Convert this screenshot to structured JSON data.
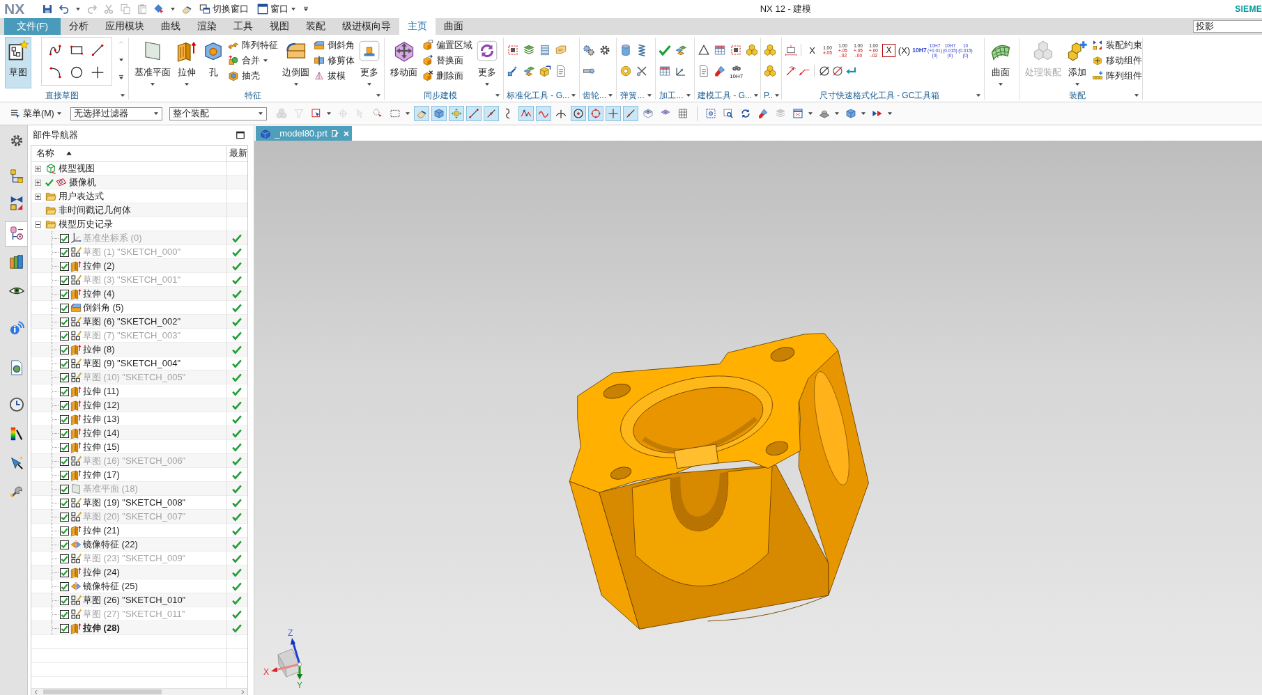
{
  "title_bar": {
    "logo": "NX",
    "quick_access": [
      {
        "label": "切换窗口",
        "dropdown": false
      },
      {
        "label": "窗口",
        "dropdown": true
      }
    ],
    "title": "NX 12 - 建模",
    "brand": "SIEME"
  },
  "menu_tabs": [
    {
      "label": "文件(F)",
      "kind": "file",
      "selected": false
    },
    {
      "label": "分析",
      "kind": "tab",
      "selected": false
    },
    {
      "label": "应用模块",
      "kind": "tab",
      "selected": false
    },
    {
      "label": "曲线",
      "kind": "tab",
      "selected": false
    },
    {
      "label": "渲染",
      "kind": "tab",
      "selected": false
    },
    {
      "label": "工具",
      "kind": "tab",
      "selected": false
    },
    {
      "label": "视图",
      "kind": "tab",
      "selected": false
    },
    {
      "label": "装配",
      "kind": "tab",
      "selected": false
    },
    {
      "label": "级进模向导",
      "kind": "tab",
      "selected": false
    },
    {
      "label": "主页",
      "kind": "tab",
      "selected": true
    },
    {
      "label": "曲面",
      "kind": "tab",
      "selected": false
    }
  ],
  "command_search": {
    "value": "投影"
  },
  "ribbon_groups": [
    {
      "label": "直接草图",
      "columns": [
        {
          "kind": "large",
          "label": "草图",
          "active": true,
          "disabled": false,
          "dropdown": false
        },
        {
          "kind": "gallery"
        }
      ]
    },
    {
      "label": "特征",
      "columns": [
        {
          "kind": "large",
          "label": "基准平面",
          "active": false,
          "disabled": false,
          "dropdown": true
        },
        {
          "kind": "large",
          "label": "拉伸",
          "active": false,
          "disabled": false,
          "dropdown": true
        },
        {
          "kind": "large",
          "label": "孔",
          "active": false,
          "disabled": false,
          "dropdown": false
        },
        {
          "kind": "stack",
          "items": [
            {
              "label": "阵列特征",
              "dropdown": false
            },
            {
              "label": "合并",
              "dropdown": true
            },
            {
              "label": "抽壳",
              "dropdown": false
            }
          ]
        },
        {
          "kind": "large",
          "label": "边倒圆",
          "active": false,
          "disabled": false,
          "dropdown": true
        },
        {
          "kind": "stack",
          "items": [
            {
              "label": "倒斜角",
              "dropdown": false
            },
            {
              "label": "修剪体",
              "dropdown": false
            },
            {
              "label": "拔模",
              "dropdown": false
            }
          ]
        },
        {
          "kind": "large",
          "label": "更多",
          "active": false,
          "disabled": false,
          "dropdown": true
        }
      ]
    },
    {
      "label": "同步建模",
      "columns": [
        {
          "kind": "large",
          "label": "移动面",
          "active": false,
          "disabled": false,
          "dropdown": false
        },
        {
          "kind": "stack",
          "items": [
            {
              "label": "偏置区域",
              "dropdown": false
            },
            {
              "label": "替换面",
              "dropdown": false
            },
            {
              "label": "删除面",
              "dropdown": false
            }
          ]
        },
        {
          "kind": "large",
          "label": "更多",
          "active": false,
          "disabled": false,
          "dropdown": true
        }
      ]
    },
    {
      "label": "标准化工具 - G...",
      "columns": [
        {
          "kind": "icons"
        }
      ]
    },
    {
      "label": "齿轮...",
      "columns": [
        {
          "kind": "icons"
        }
      ]
    },
    {
      "label": "弹簧...",
      "columns": [
        {
          "kind": "icons"
        }
      ]
    },
    {
      "label": "加工...",
      "columns": [
        {
          "kind": "icons"
        }
      ]
    },
    {
      "label": "建模工具 - G...",
      "columns": [
        {
          "kind": "icons",
          "caption": "10H7"
        }
      ]
    },
    {
      "label": "P..",
      "columns": [
        {
          "kind": "icons"
        }
      ]
    },
    {
      "label": "尺寸快速格式化工具 - GC工具箱",
      "columns": [
        {
          "kind": "format_tools",
          "buttons": [
            {
              "kind": "plain",
              "lines": [
                "X"
              ]
            },
            {
              "kind": "tolerance",
              "lines": [
                "1.00",
                "±.05"
              ]
            },
            {
              "kind": "tolerance",
              "lines": [
                "1.00",
                "+.05",
                "-.02"
              ]
            },
            {
              "kind": "tolerance",
              "lines": [
                "1.00",
                "+.05",
                "-.00"
              ]
            },
            {
              "kind": "tolerance",
              "lines": [
                "1.00",
                "+.00",
                "-.02"
              ]
            },
            {
              "kind": "boxed",
              "lines": [
                "X"
              ]
            },
            {
              "kind": "plain",
              "lines": [
                "(X)"
              ]
            },
            {
              "kind": "fit",
              "lines": [
                "10H7"
              ]
            },
            {
              "kind": "fit",
              "lines": [
                "10H7",
                "(+0.01)",
                "(0)"
              ]
            },
            {
              "kind": "fit",
              "lines": [
                "10H7",
                "(0.015)",
                "(0)"
              ]
            },
            {
              "kind": "fit",
              "lines": [
                "10",
                "(0.015)",
                "(0)"
              ]
            }
          ]
        }
      ]
    },
    {
      "columns": [
        {
          "kind": "large",
          "label": "曲面",
          "active": false,
          "disabled": false,
          "dropdown": true
        }
      ]
    },
    {
      "label": "装配",
      "columns": [
        {
          "kind": "large",
          "label": "处理装配",
          "active": false,
          "disabled": true,
          "dropdown": false
        },
        {
          "kind": "large",
          "label": "添加",
          "active": false,
          "disabled": false,
          "dropdown": true
        },
        {
          "kind": "stack",
          "items": [
            {
              "label": "装配约束",
              "dropdown": false
            },
            {
              "label": "移动组件",
              "dropdown": false
            },
            {
              "label": "阵列组件",
              "dropdown": false
            }
          ]
        }
      ]
    }
  ],
  "selection_bar": {
    "menu": "菜单(M)",
    "filters": [
      "无选择过滤器",
      "整个装配"
    ],
    "tools": [
      {
        "on": false,
        "disabled": true
      },
      {
        "on": false,
        "disabled": true
      },
      {
        "on": false,
        "disabled": false
      },
      {
        "on": false,
        "disabled": true
      },
      {
        "on": false,
        "disabled": true
      },
      {
        "on": false,
        "disabled": false
      },
      {
        "on": false,
        "disabled": false
      },
      {
        "on": true,
        "disabled": false
      },
      {
        "on": true,
        "disabled": false
      },
      {
        "on": true,
        "disabled": false
      },
      {
        "on": true,
        "disabled": false
      },
      {
        "on": true,
        "disabled": false
      },
      {
        "on": false,
        "disabled": false
      },
      {
        "on": true,
        "disabled": false
      },
      {
        "on": true,
        "disabled": false
      },
      {
        "on": false,
        "disabled": false
      },
      {
        "on": true,
        "disabled": false
      },
      {
        "on": true,
        "disabled": false
      },
      {
        "on": true,
        "disabled": false
      },
      {
        "on": true,
        "disabled": false
      },
      {
        "on": false,
        "disabled": false
      },
      {
        "on": false,
        "disabled": false
      },
      {
        "on": false,
        "disabled": false
      },
      {
        "on": false,
        "disabled": false
      },
      {
        "on": false,
        "disabled": false
      },
      {
        "on": false,
        "disabled": false
      },
      {
        "on": false,
        "disabled": false
      },
      {
        "on": false,
        "disabled": true
      },
      {
        "on": false,
        "disabled": false
      },
      {
        "on": false,
        "disabled": false
      },
      {
        "on": false,
        "disabled": false
      },
      {
        "on": false,
        "disabled": false
      }
    ]
  },
  "resource_bar": [
    {
      "selected": false
    },
    {
      "selected": false
    },
    {
      "selected": false
    },
    {
      "selected": true
    },
    {
      "selected": false
    },
    {
      "selected": false
    },
    {
      "selected": false
    },
    {
      "selected": false
    },
    {
      "selected": false
    },
    {
      "selected": false
    },
    {
      "selected": false
    },
    {
      "selected": false
    }
  ],
  "part_navigator": {
    "title": "部件导航器",
    "columns": [
      {
        "label": "名称",
        "sort_ascending": true
      },
      {
        "label": "最新"
      }
    ],
    "nodes": [
      {
        "kind": "model_views",
        "label": "模型视图",
        "expandable": true,
        "expanded": false,
        "status_ok": false
      },
      {
        "kind": "cameras",
        "label": "摄像机",
        "expandable": true,
        "expanded": false,
        "status_ok": true
      },
      {
        "kind": "expressions",
        "label": "用户表达式",
        "expandable": true,
        "expanded": false,
        "status_ok": false
      },
      {
        "kind": "unused_geometry",
        "label": "非时间戳记几何体",
        "expandable": false,
        "status_ok": false
      },
      {
        "kind": "history",
        "label": "模型历史记录",
        "expandable": true,
        "expanded": true,
        "status_ok": false,
        "children": [
          {
            "kind": "datum_csys",
            "label": "基准坐标系 (0)",
            "checked": true,
            "dimmed": true,
            "current": false,
            "up_to_date": true
          },
          {
            "kind": "sketch",
            "label": "草图 (1) \"SKETCH_000\"",
            "checked": true,
            "dimmed": true,
            "current": false,
            "up_to_date": true
          },
          {
            "kind": "extrude",
            "label": "拉伸 (2)",
            "checked": true,
            "dimmed": false,
            "current": false,
            "up_to_date": true
          },
          {
            "kind": "sketch",
            "label": "草图 (3) \"SKETCH_001\"",
            "checked": true,
            "dimmed": true,
            "current": false,
            "up_to_date": true
          },
          {
            "kind": "extrude",
            "label": "拉伸 (4)",
            "checked": true,
            "dimmed": false,
            "current": false,
            "up_to_date": true
          },
          {
            "kind": "chamfer",
            "label": "倒斜角 (5)",
            "checked": true,
            "dimmed": false,
            "current": false,
            "up_to_date": true
          },
          {
            "kind": "sketch",
            "label": "草图 (6) \"SKETCH_002\"",
            "checked": true,
            "dimmed": false,
            "current": false,
            "up_to_date": true
          },
          {
            "kind": "sketch",
            "label": "草图 (7) \"SKETCH_003\"",
            "checked": true,
            "dimmed": true,
            "current": false,
            "up_to_date": true
          },
          {
            "kind": "extrude",
            "label": "拉伸 (8)",
            "checked": true,
            "dimmed": false,
            "current": false,
            "up_to_date": true
          },
          {
            "kind": "sketch",
            "label": "草图 (9) \"SKETCH_004\"",
            "checked": true,
            "dimmed": false,
            "current": false,
            "up_to_date": true
          },
          {
            "kind": "sketch",
            "label": "草图 (10) \"SKETCH_005\"",
            "checked": true,
            "dimmed": true,
            "current": false,
            "up_to_date": true
          },
          {
            "kind": "extrude",
            "label": "拉伸 (11)",
            "checked": true,
            "dimmed": false,
            "current": false,
            "up_to_date": true
          },
          {
            "kind": "extrude",
            "label": "拉伸 (12)",
            "checked": true,
            "dimmed": false,
            "current": false,
            "up_to_date": true
          },
          {
            "kind": "extrude",
            "label": "拉伸 (13)",
            "checked": true,
            "dimmed": false,
            "current": false,
            "up_to_date": true
          },
          {
            "kind": "extrude",
            "label": "拉伸 (14)",
            "checked": true,
            "dimmed": false,
            "current": false,
            "up_to_date": true
          },
          {
            "kind": "extrude",
            "label": "拉伸 (15)",
            "checked": true,
            "dimmed": false,
            "current": false,
            "up_to_date": true
          },
          {
            "kind": "sketch",
            "label": "草图 (16) \"SKETCH_006\"",
            "checked": true,
            "dimmed": true,
            "current": false,
            "up_to_date": true
          },
          {
            "kind": "extrude",
            "label": "拉伸 (17)",
            "checked": true,
            "dimmed": false,
            "current": false,
            "up_to_date": true
          },
          {
            "kind": "datum_plane",
            "label": "基准平面 (18)",
            "checked": true,
            "dimmed": true,
            "current": false,
            "up_to_date": true
          },
          {
            "kind": "sketch",
            "label": "草图 (19) \"SKETCH_008\"",
            "checked": true,
            "dimmed": false,
            "current": false,
            "up_to_date": true
          },
          {
            "kind": "sketch",
            "label": "草图 (20) \"SKETCH_007\"",
            "checked": true,
            "dimmed": true,
            "current": false,
            "up_to_date": true
          },
          {
            "kind": "extrude",
            "label": "拉伸 (21)",
            "checked": true,
            "dimmed": false,
            "current": false,
            "up_to_date": true
          },
          {
            "kind": "mirror",
            "label": "镜像特征 (22)",
            "checked": true,
            "dimmed": false,
            "current": false,
            "up_to_date": true
          },
          {
            "kind": "sketch",
            "label": "草图 (23) \"SKETCH_009\"",
            "checked": true,
            "dimmed": true,
            "current": false,
            "up_to_date": true
          },
          {
            "kind": "extrude",
            "label": "拉伸 (24)",
            "checked": true,
            "dimmed": false,
            "current": false,
            "up_to_date": true
          },
          {
            "kind": "mirror",
            "label": "镜像特征 (25)",
            "checked": true,
            "dimmed": false,
            "current": false,
            "up_to_date": true
          },
          {
            "kind": "sketch",
            "label": "草图 (26) \"SKETCH_010\"",
            "checked": true,
            "dimmed": false,
            "current": false,
            "up_to_date": true
          },
          {
            "kind": "sketch",
            "label": "草图 (27) \"SKETCH_011\"",
            "checked": true,
            "dimmed": true,
            "current": false,
            "up_to_date": true
          },
          {
            "kind": "extrude",
            "label": "拉伸 (28)",
            "checked": true,
            "dimmed": false,
            "current": true,
            "up_to_date": true
          }
        ]
      }
    ]
  },
  "viewport": {
    "tabs": [
      {
        "label": "_model80.prt",
        "selected": true
      }
    ],
    "triad": {
      "x_label": "X",
      "y_label": "Y",
      "z_label": "Z"
    }
  }
}
